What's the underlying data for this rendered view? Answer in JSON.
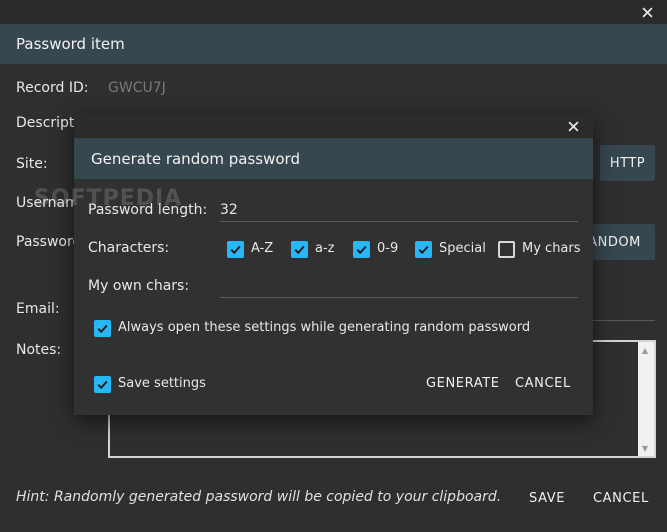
{
  "window": {
    "title": "Password item"
  },
  "form": {
    "record_id_label": "Record ID:",
    "record_id_value": "GWCU7J",
    "description_label": "Description:",
    "site_label": "Site:",
    "username_label": "Username:",
    "password_label": "Password:",
    "email_label": "Email:",
    "notes_label": "Notes:",
    "http_button": "HTTP",
    "random_button": "RANDOM",
    "hint": "Hint: Randomly generated password will be copied to your clipboard.",
    "save_button": "SAVE",
    "cancel_button": "CANCEL"
  },
  "watermark": "SOFTPEDIA",
  "modal": {
    "title": "Generate random password",
    "length_label": "Password length:",
    "length_value": "32",
    "characters_label": "Characters:",
    "charsets": [
      {
        "label": "A-Z",
        "checked": true
      },
      {
        "label": "a-z",
        "checked": true
      },
      {
        "label": "0-9",
        "checked": true
      },
      {
        "label": "Special",
        "checked": true
      },
      {
        "label": "My chars",
        "checked": false
      }
    ],
    "own_chars_label": "My own chars:",
    "own_chars_value": "",
    "always_open_label": "Always open these settings while generating random password",
    "always_open_checked": true,
    "save_settings_label": "Save settings",
    "save_settings_checked": true,
    "generate_button": "GENERATE",
    "cancel_button": "CANCEL"
  },
  "colors": {
    "accent": "#29b6f6",
    "header": "#37474f",
    "background": "#2f2f2f"
  },
  "icons": {
    "close": "close-icon",
    "check": "checkmark-icon"
  }
}
